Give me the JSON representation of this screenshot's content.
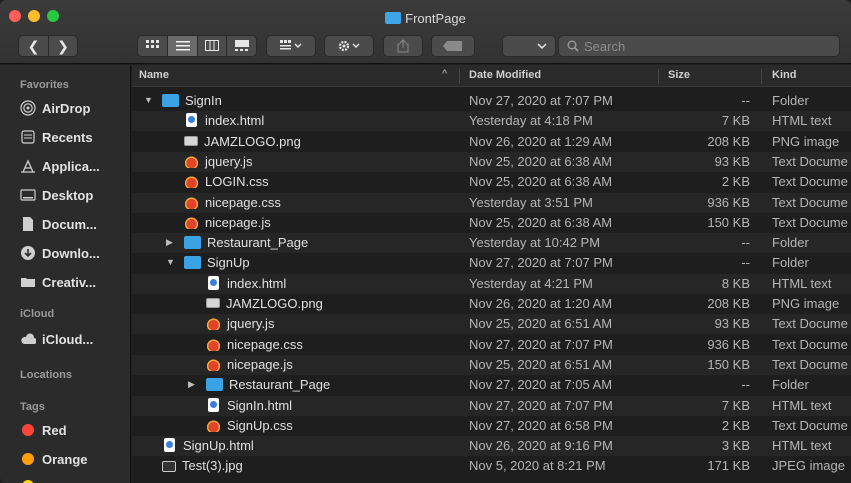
{
  "window": {
    "title": "FrontPage",
    "back_label": "❮",
    "forward_label": "❯",
    "search_placeholder": "Search"
  },
  "sidebar": {
    "favorites_header": "Favorites",
    "favorites": [
      {
        "label": "AirDrop",
        "icon": "airdrop-icon"
      },
      {
        "label": "Recents",
        "icon": "recents-icon"
      },
      {
        "label": "Applica...",
        "icon": "applications-icon"
      },
      {
        "label": "Desktop",
        "icon": "desktop-icon"
      },
      {
        "label": "Docum...",
        "icon": "documents-icon"
      },
      {
        "label": "Downlo...",
        "icon": "downloads-icon"
      },
      {
        "label": "Creativ...",
        "icon": "folder-icon"
      }
    ],
    "icloud_header": "iCloud",
    "icloud": [
      {
        "label": "iCloud...",
        "icon": "icloud-icon"
      }
    ],
    "locations_header": "Locations",
    "tags_header": "Tags",
    "tags": [
      {
        "label": "Red",
        "color": "#ff453a"
      },
      {
        "label": "Orange",
        "color": "#ff9f0a"
      }
    ]
  },
  "columns": {
    "name": "Name",
    "date": "Date Modified",
    "size": "Size",
    "kind": "Kind"
  },
  "rows": [
    {
      "name": "SignIn",
      "date": "Nov 27, 2020 at 7:07 PM",
      "size": "--",
      "kind": "Folder",
      "type": "folder"
    },
    {
      "name": "index.html",
      "date": "Yesterday at 4:18 PM",
      "size": "7 KB",
      "kind": "HTML text",
      "type": "html"
    },
    {
      "name": "JAMZLOGO.png",
      "date": "Nov 26, 2020 at 1:29 AM",
      "size": "208 KB",
      "kind": "PNG image",
      "type": "png"
    },
    {
      "name": "jquery.js",
      "date": "Nov 25, 2020 at 6:38 AM",
      "size": "93 KB",
      "kind": "Text Docume",
      "type": "code"
    },
    {
      "name": "LOGIN.css",
      "date": "Nov 25, 2020 at 6:38 AM",
      "size": "2 KB",
      "kind": "Text Docume",
      "type": "code"
    },
    {
      "name": "nicepage.css",
      "date": "Yesterday at 3:51 PM",
      "size": "936 KB",
      "kind": "Text Docume",
      "type": "code"
    },
    {
      "name": "nicepage.js",
      "date": "Nov 25, 2020 at 6:38 AM",
      "size": "150 KB",
      "kind": "Text Docume",
      "type": "code"
    },
    {
      "name": "Restaurant_Page",
      "date": "Yesterday at 10:42 PM",
      "size": "--",
      "kind": "Folder",
      "type": "folder"
    },
    {
      "name": "SignUp",
      "date": "Nov 27, 2020 at 7:07 PM",
      "size": "--",
      "kind": "Folder",
      "type": "folder"
    },
    {
      "name": "index.html",
      "date": "Yesterday at 4:21 PM",
      "size": "8 KB",
      "kind": "HTML text",
      "type": "html"
    },
    {
      "name": "JAMZLOGO.png",
      "date": "Nov 26, 2020 at 1:20 AM",
      "size": "208 KB",
      "kind": "PNG image",
      "type": "png"
    },
    {
      "name": "jquery.js",
      "date": "Nov 25, 2020 at 6:51 AM",
      "size": "93 KB",
      "kind": "Text Docume",
      "type": "code"
    },
    {
      "name": "nicepage.css",
      "date": "Nov 27, 2020 at 7:07 PM",
      "size": "936 KB",
      "kind": "Text Docume",
      "type": "code"
    },
    {
      "name": "nicepage.js",
      "date": "Nov 25, 2020 at 6:51 AM",
      "size": "150 KB",
      "kind": "Text Docume",
      "type": "code"
    },
    {
      "name": "Restaurant_Page",
      "date": "Nov 27, 2020 at 7:05 AM",
      "size": "--",
      "kind": "Folder",
      "type": "folder"
    },
    {
      "name": "SignIn.html",
      "date": "Nov 27, 2020 at 7:07 PM",
      "size": "7 KB",
      "kind": "HTML text",
      "type": "html"
    },
    {
      "name": "SignUp.css",
      "date": "Nov 27, 2020 at 6:58 PM",
      "size": "2 KB",
      "kind": "Text Docume",
      "type": "code"
    },
    {
      "name": "SignUp.html",
      "date": "Nov 26, 2020 at 9:16 PM",
      "size": "3 KB",
      "kind": "HTML text",
      "type": "html"
    },
    {
      "name": "Test(3).jpg",
      "date": "Nov 5, 2020 at 8:21 PM",
      "size": "171 KB",
      "kind": "JPEG image",
      "type": "jpg"
    }
  ]
}
